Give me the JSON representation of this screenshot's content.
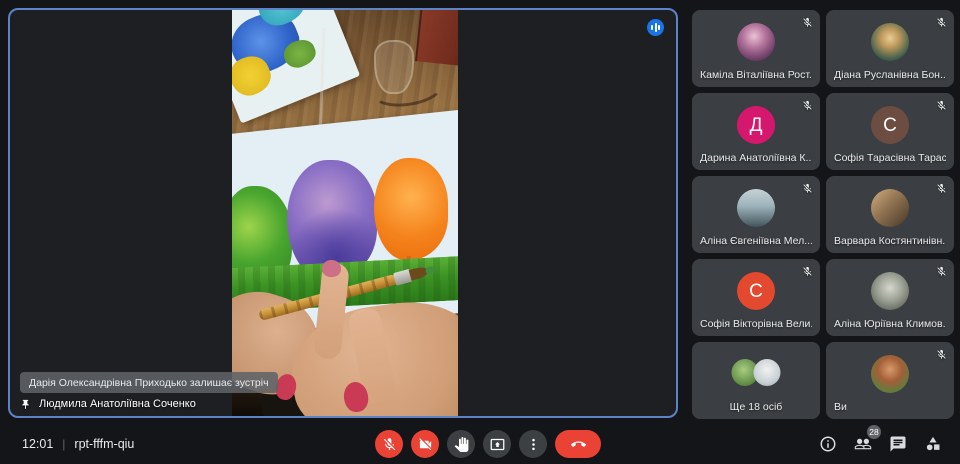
{
  "meeting": {
    "time": "12:01",
    "divider": "|",
    "code": "rpt-fffm-qiu",
    "toast": "Дарія Олександрівна Приходько залишає зустріч",
    "pinned_name": "Людмила Анатоліївна Соченко"
  },
  "colors": {
    "active_speaker_border": "#5c84c6",
    "control_red": "#ea4335",
    "control_dark": "#3c4043",
    "audio_indicator_blue": "#1a73e8",
    "badge_gray": "#5f6368"
  },
  "icons": {
    "audio": "audio-level-indicator",
    "pin": "pin-icon",
    "mic": "mic-off-icon",
    "camera": "camera-off-icon",
    "hand": "raise-hand-icon",
    "present": "present-screen-icon",
    "more": "more-options-icon",
    "end": "call-end-icon",
    "info": "info-icon",
    "people": "people-icon",
    "chat": "chat-icon",
    "activities": "activities-icon"
  },
  "panel": {
    "participants_badge": "28"
  },
  "participants": [
    {
      "name": "Каміла Віталіївна Рост...",
      "avatar": "photo",
      "muted": true
    },
    {
      "name": "Діана Русланівна Бон...",
      "avatar": "photo",
      "muted": true
    },
    {
      "name": "Дарина Анатоліївна К...",
      "avatar": "initial",
      "initial": "Д",
      "color": "#d5186e",
      "muted": true
    },
    {
      "name": "Софія Тарасівна Тарас...",
      "avatar": "initial",
      "initial": "С",
      "color": "#6d4c41",
      "muted": true
    },
    {
      "name": "Аліна Євгеніївна Мел...",
      "avatar": "photo",
      "muted": true
    },
    {
      "name": "Варвара Костянтинівн...",
      "avatar": "photo",
      "muted": true
    },
    {
      "name": "Софія Вікторівна Вели...",
      "avatar": "initial",
      "initial": "С",
      "color": "#e2492f",
      "muted": true
    },
    {
      "name": "Аліна Юріївна Климов...",
      "avatar": "photo",
      "muted": true
    },
    {
      "name": "Ще 18 осіб",
      "avatar": "pair",
      "muted": false,
      "overflow": true
    },
    {
      "name": "Ви",
      "avatar": "photo",
      "muted": true,
      "self": true
    }
  ]
}
